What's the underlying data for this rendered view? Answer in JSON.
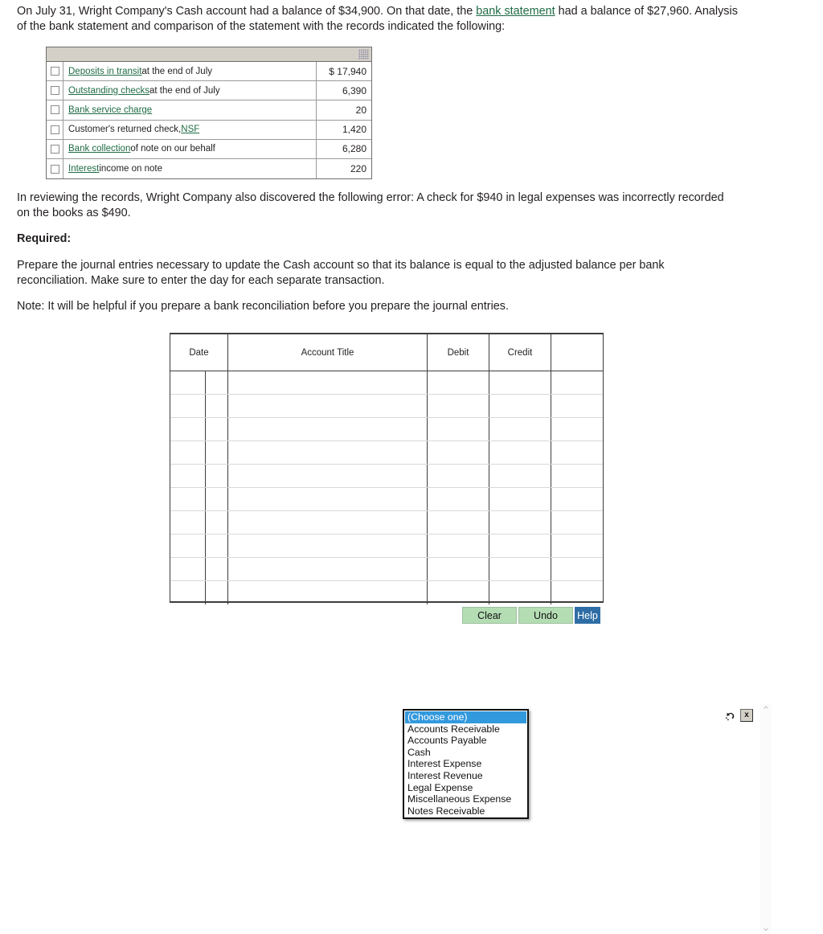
{
  "problem": {
    "intro_before_link": "On July 31, Wright Company's Cash account had a balance of $34,900. On that date, the ",
    "intro_link": "bank statement",
    "intro_after_link": " had a balance of $27,960. Analysis of the bank statement and comparison of the statement with the records indicated the following:",
    "error_paragraph": "In reviewing the records, Wright Company also discovered the following error: A check for $940 in legal expenses was incorrectly recorded on the books as $490.",
    "required_heading": "Required:",
    "task_paragraph": "Prepare the journal entries necessary to update the Cash account so that its balance is equal to the adjusted balance per bank reconciliation. Make sure to enter the day for each separate transaction.",
    "note_paragraph": "Note: It will be helpful if you prepare a bank reconciliation before you prepare the journal entries."
  },
  "reconciliation_table": {
    "rows": [
      {
        "link": "Deposits in transit",
        "rest": " at the end of July",
        "amount": "$ 17,940"
      },
      {
        "link": "Outstanding checks",
        "rest": " at the end of July",
        "amount": "6,390"
      },
      {
        "link": "Bank service charge",
        "rest": "",
        "amount": "20"
      },
      {
        "pre": "Customer's returned check, ",
        "link": "NSF",
        "rest": "",
        "amount": "1,420"
      },
      {
        "link": "Bank collection",
        "rest": " of note on our behalf",
        "amount": "6,280"
      },
      {
        "link": "Interest",
        "rest": " income on note",
        "amount": "220"
      }
    ]
  },
  "journal": {
    "headers": {
      "date": "Date",
      "account_title": "Account Title",
      "debit": "Debit",
      "credit": "Credit",
      "tools": ""
    },
    "row_count": 10,
    "dropdown": {
      "options": [
        "(Choose one)",
        "Accounts Receivable",
        "Accounts Payable",
        "Cash",
        "Interest Expense",
        "Interest Revenue",
        "Legal Expense",
        "Miscellaneous Expense",
        "Notes Receivable"
      ],
      "selected_index": 0
    },
    "row_tools": {
      "undo_icon": "undo-arrow-icon",
      "delete_label": "x"
    },
    "scrollbar": {
      "up_arrow": "⌃",
      "down_arrow": "⌄"
    }
  },
  "actions": {
    "clear": "Clear",
    "undo": "Undo",
    "help": "Help"
  },
  "colors": {
    "link_green": "#1f6b45",
    "dropdown_highlight": "#3399dd",
    "button_green": "#b4ddb4",
    "button_blue": "#2f6ea5"
  }
}
